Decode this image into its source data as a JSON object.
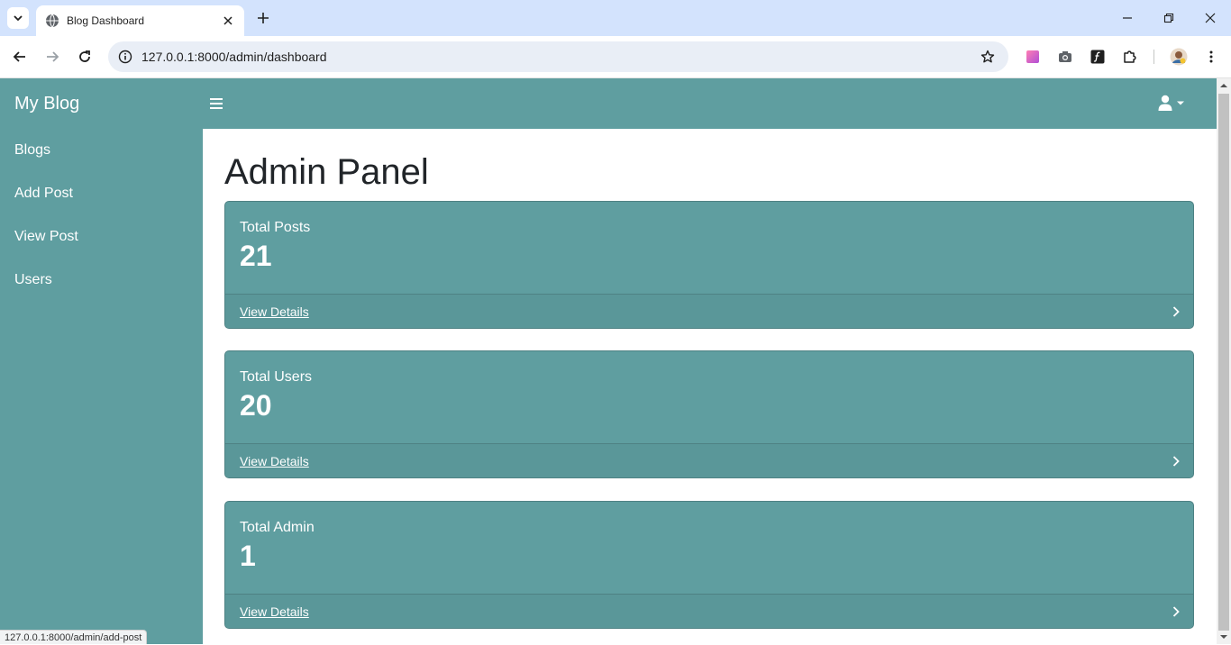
{
  "browser": {
    "tab_title": "Blog Dashboard",
    "url": "127.0.0.1:8000/admin/dashboard",
    "status_url": "127.0.0.1:8000/admin/add-post"
  },
  "sidebar": {
    "brand": "My Blog",
    "items": [
      {
        "label": "Blogs"
      },
      {
        "label": "Add Post"
      },
      {
        "label": "View Post"
      },
      {
        "label": "Users"
      }
    ]
  },
  "main": {
    "title": "Admin Panel",
    "cards": [
      {
        "label": "Total Posts",
        "value": "21",
        "link": "View Details"
      },
      {
        "label": "Total Users",
        "value": "20",
        "link": "View Details"
      },
      {
        "label": "Total Admin",
        "value": "1",
        "link": "View Details"
      }
    ]
  },
  "colors": {
    "accent": "#5f9ea0",
    "browser_tabstrip": "#d3e3fd",
    "omnibox": "#e9eef6"
  }
}
